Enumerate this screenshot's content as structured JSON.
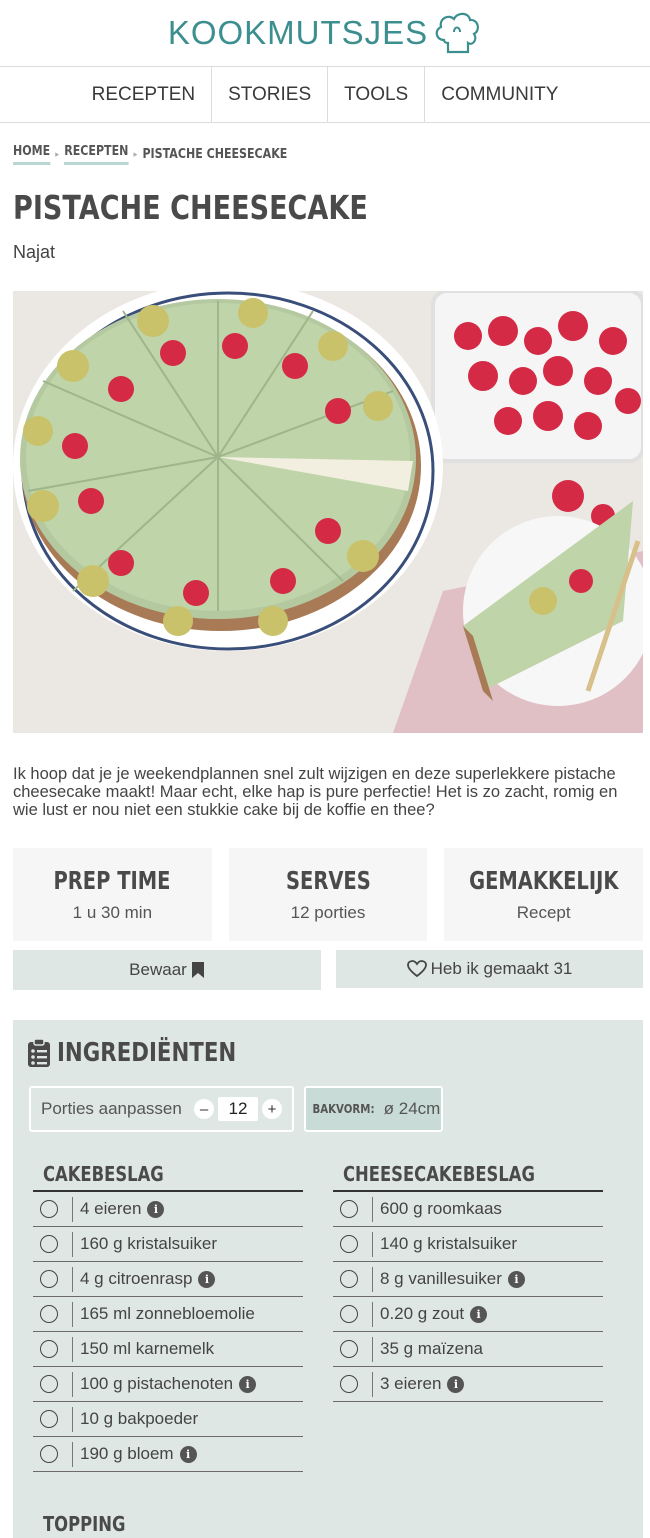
{
  "header": {
    "logo_text": "KOOKMUTSJES",
    "brand_color": "#3d8f8f"
  },
  "nav": {
    "items": [
      "RECEPTEN",
      "STORIES",
      "TOOLS",
      "COMMUNITY"
    ]
  },
  "breadcrumb": {
    "items": [
      "HOME",
      "RECEPTEN",
      "PISTACHE CHEESECAKE"
    ]
  },
  "recipe": {
    "title": "PISTACHE CHEESECAKE",
    "author": "Najat",
    "intro": "Ik hoop dat je je weekendplannen snel zult wijzigen en deze superlekkere pistache cheesecake maakt! Maar echt, elke hap is pure perfectie! Het is zo zacht, romig en wie lust er nou niet een stukkie cake bij de koffie en thee?",
    "stats": [
      {
        "label": "PREP TIME",
        "value": "1 u 30 min"
      },
      {
        "label": "SERVES",
        "value": "12 porties"
      },
      {
        "label": "GEMAKKELIJK",
        "value": "Recept"
      }
    ],
    "actions": {
      "save_label": "Bewaar",
      "made_label": "Heb ik gemaakt 31"
    }
  },
  "ingredients": {
    "title": "INGREDIËNTEN",
    "portions_label": "Porties aanpassen",
    "portions_value": "12",
    "bakvorm_label": "BAKVORM:",
    "bakvorm_value": "ø 24cm",
    "groups": [
      {
        "title": "CAKEBESLAG",
        "items": [
          {
            "text": "4 eieren",
            "info": true
          },
          {
            "text": "160 g kristalsuiker",
            "info": false
          },
          {
            "text": "4 g citroenrasp",
            "info": true
          },
          {
            "text": "165 ml zonnebloemolie",
            "info": false
          },
          {
            "text": "150 ml karnemelk",
            "info": false
          },
          {
            "text": "100 g pistachenoten",
            "info": true
          },
          {
            "text": "10 g bakpoeder",
            "info": false
          },
          {
            "text": "190 g bloem",
            "info": true
          }
        ]
      },
      {
        "title": "CHEESECAKEBESLAG",
        "items": [
          {
            "text": "600 g roomkaas",
            "info": false
          },
          {
            "text": "140 g kristalsuiker",
            "info": false
          },
          {
            "text": "8 g vanillesuiker",
            "info": true
          },
          {
            "text": "0.20 g zout",
            "info": true
          },
          {
            "text": "35 g maïzena",
            "info": false
          },
          {
            "text": "3 eieren",
            "info": true
          }
        ]
      }
    ],
    "topping_title": "TOPPING"
  }
}
